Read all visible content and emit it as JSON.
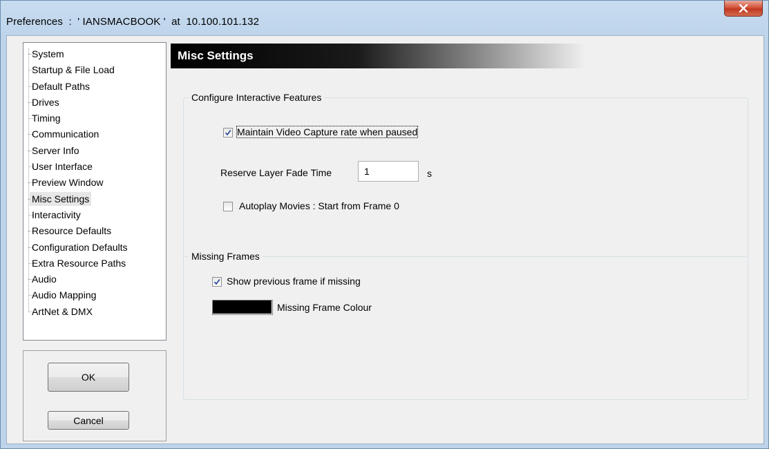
{
  "window": {
    "title": "Preferences  :  ' IANSMACBOOK '  at  10.100.101.132",
    "close_glyph": "X"
  },
  "nav": {
    "items": [
      {
        "label": "System"
      },
      {
        "label": "Startup & File Load"
      },
      {
        "label": "Default Paths"
      },
      {
        "label": "Drives"
      },
      {
        "label": "Timing"
      },
      {
        "label": "Communication"
      },
      {
        "label": "Server Info"
      },
      {
        "label": "User Interface"
      },
      {
        "label": "Preview Window"
      },
      {
        "label": "Misc Settings",
        "selected": true
      },
      {
        "label": "Interactivity"
      },
      {
        "label": "Resource Defaults"
      },
      {
        "label": "Configuration Defaults"
      },
      {
        "label": "Extra Resource Paths"
      },
      {
        "label": "Audio"
      },
      {
        "label": "Audio Mapping"
      },
      {
        "label": "ArtNet & DMX"
      }
    ]
  },
  "buttons": {
    "ok_label": "OK",
    "cancel_label": "Cancel"
  },
  "page": {
    "title": "Misc Settings"
  },
  "interactive": {
    "group_label": "Configure Interactive Features",
    "maintain_capture_label": "Maintain Video Capture rate when paused",
    "maintain_capture_checked": true,
    "fade_time_label": "Reserve Layer Fade Time",
    "fade_time_value": "1",
    "fade_time_unit": "s",
    "autoplay_label": "Autoplay Movies : Start from Frame 0",
    "autoplay_checked": false
  },
  "missing": {
    "group_label": "Missing Frames",
    "show_previous_label": "Show previous frame if missing",
    "show_previous_checked": true,
    "colour_label": "Missing Frame Colour",
    "colour_value": "#000000"
  },
  "colors": {
    "checkmark": "#2a4a9a",
    "header_start": "#000000",
    "selected_bg": "#e6e6e6"
  }
}
